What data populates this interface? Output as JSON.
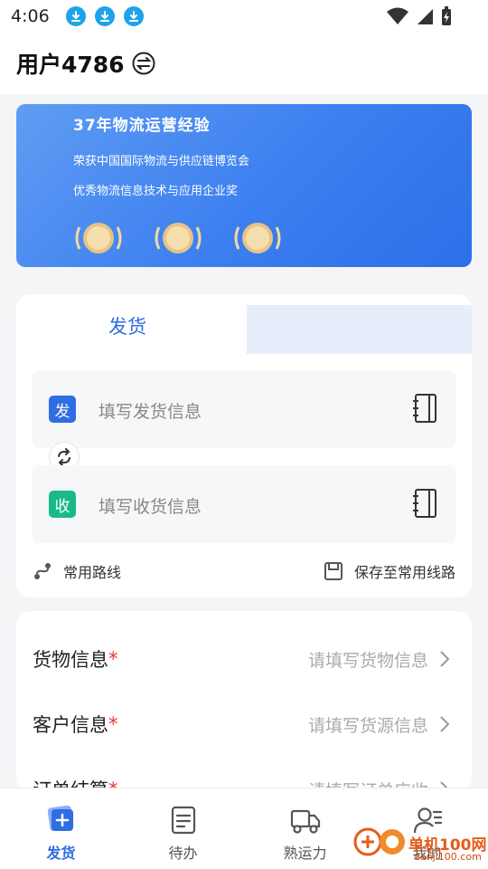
{
  "status_bar": {
    "time": "4:06"
  },
  "header": {
    "user_name": "用户4786"
  },
  "banner": {
    "title": "37年物流运营经验",
    "line1": "荣获中国国际物流与供应链博览会",
    "line2": "优秀物流信息技术与应用企业奖"
  },
  "ship": {
    "tab_label": "发货",
    "sender": {
      "badge": "发",
      "placeholder": "填写发货信息",
      "color": "#2f6de3"
    },
    "receiver": {
      "badge": "收",
      "placeholder": "填写收货信息",
      "color": "#19b98a"
    },
    "common_routes": "常用路线",
    "save_route": "保存至常用线路"
  },
  "info": {
    "rows": [
      {
        "label": "货物信息",
        "value": "请填写货物信息"
      },
      {
        "label": "客户信息",
        "value": "请填写货源信息"
      },
      {
        "label": "订单结算",
        "value": "请填写订单应收"
      }
    ]
  },
  "bottom_nav": {
    "items": [
      {
        "label": "发货",
        "icon": "ship-add-icon",
        "active": true
      },
      {
        "label": "待办",
        "icon": "todo-icon",
        "active": false
      },
      {
        "label": "熟运力",
        "icon": "truck-icon",
        "active": false
      },
      {
        "label": "我的",
        "icon": "profile-icon",
        "active": false
      }
    ]
  },
  "watermark": {
    "brand": "单机100网",
    "site": "danji100.com"
  },
  "colors": {
    "accent": "#2f6de3",
    "receiver": "#19b98a",
    "required": "#ee3333"
  }
}
